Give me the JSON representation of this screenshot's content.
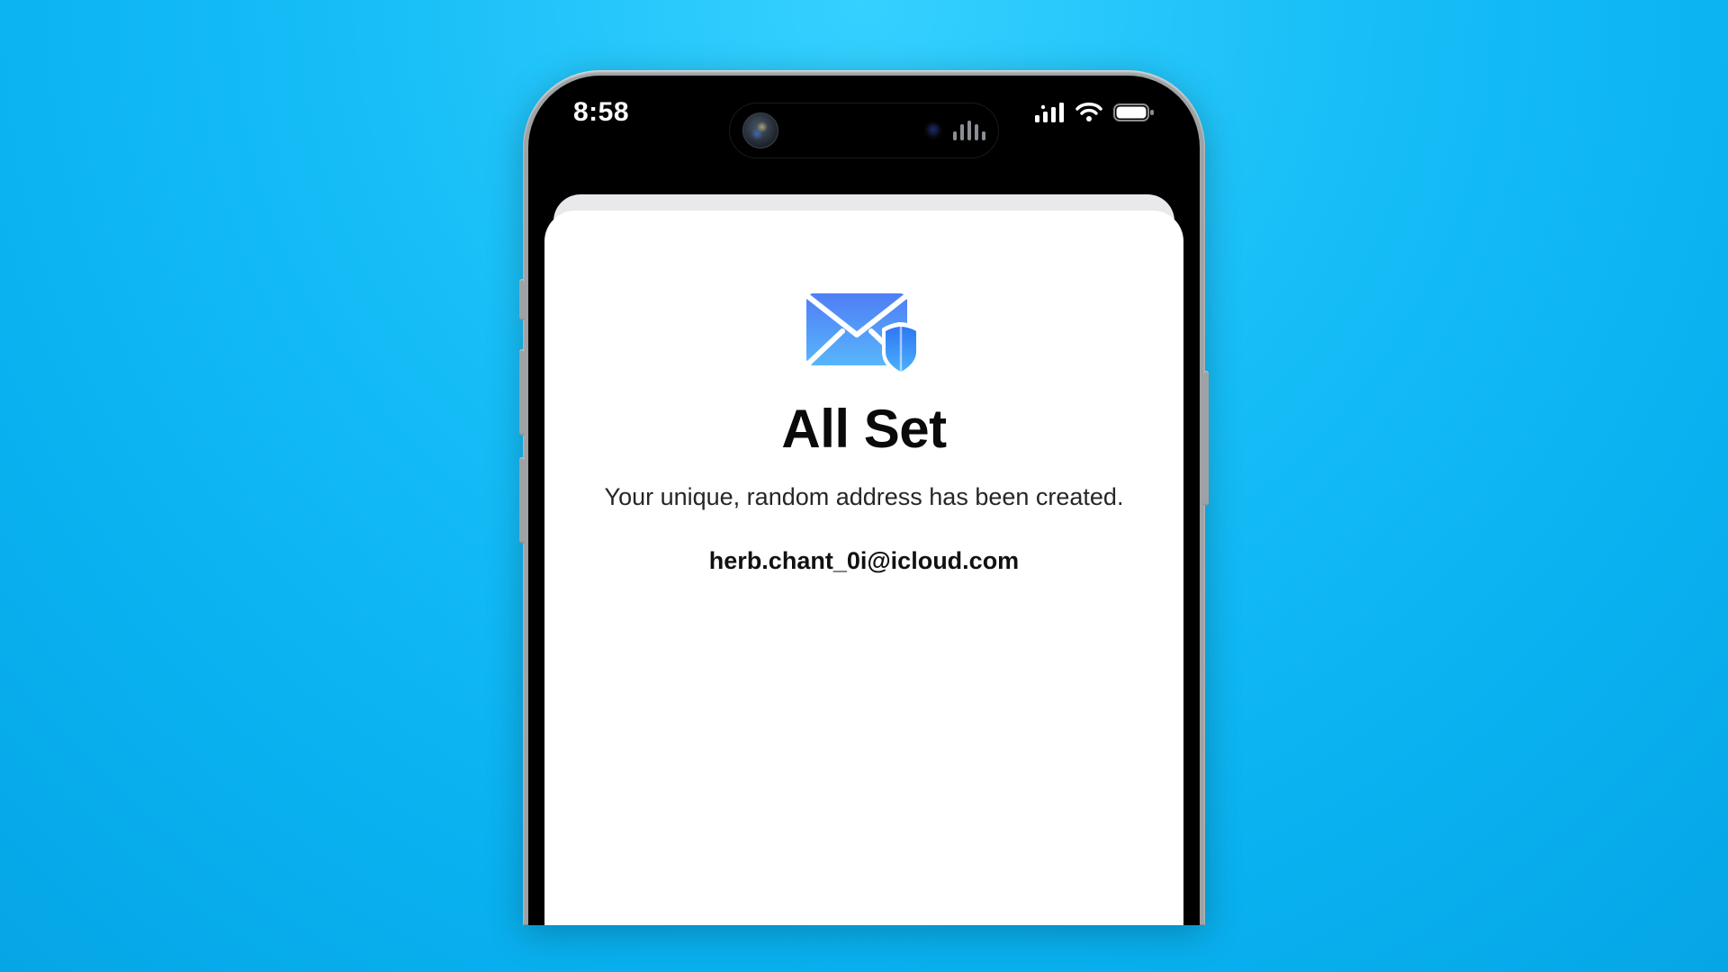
{
  "status_bar": {
    "time": "8:58"
  },
  "sheet": {
    "title": "All Set",
    "subtitle": "Your unique, random address has been created.",
    "email": "herb.chant_0i@icloud.com"
  }
}
